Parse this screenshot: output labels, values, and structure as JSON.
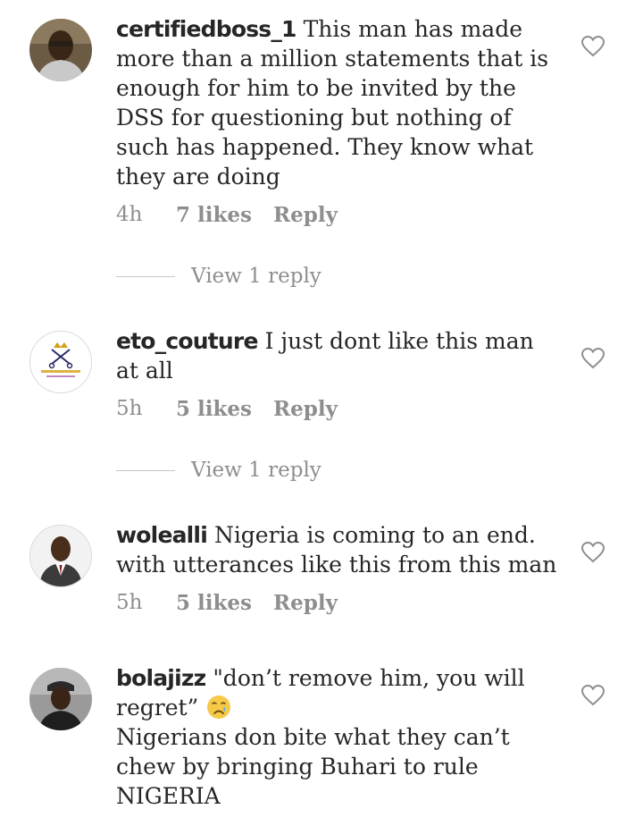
{
  "comments": [
    {
      "username": "certifiedboss_1",
      "text": "This man has made more than a million statements that is enough for him to be invited by the DSS for questioning but nothing of such has happened. They know what they are doing",
      "time": "4h",
      "likes": "7 likes",
      "reply": "Reply",
      "view_replies": "View 1 reply"
    },
    {
      "username": "eto_couture",
      "text": "I just dont like this man at all",
      "time": "5h",
      "likes": "5 likes",
      "reply": "Reply",
      "view_replies": "View 1 reply"
    },
    {
      "username": "wolealli",
      "text": "Nigeria is coming to an end. with utterances like this from this man",
      "time": "5h",
      "likes": "5 likes",
      "reply": "Reply"
    },
    {
      "username": "bolajizz",
      "text_part1": "\"don’t remove him, you will regret”",
      "emoji": "crying-face-emoji",
      "text_part2": "Nigerians don bite what they can’t chew by bringing Buhari to rule NIGERIA"
    }
  ],
  "colors": {
    "text": "#262626",
    "secondary": "#8e8e8e",
    "divider": "#c7c7c7"
  }
}
